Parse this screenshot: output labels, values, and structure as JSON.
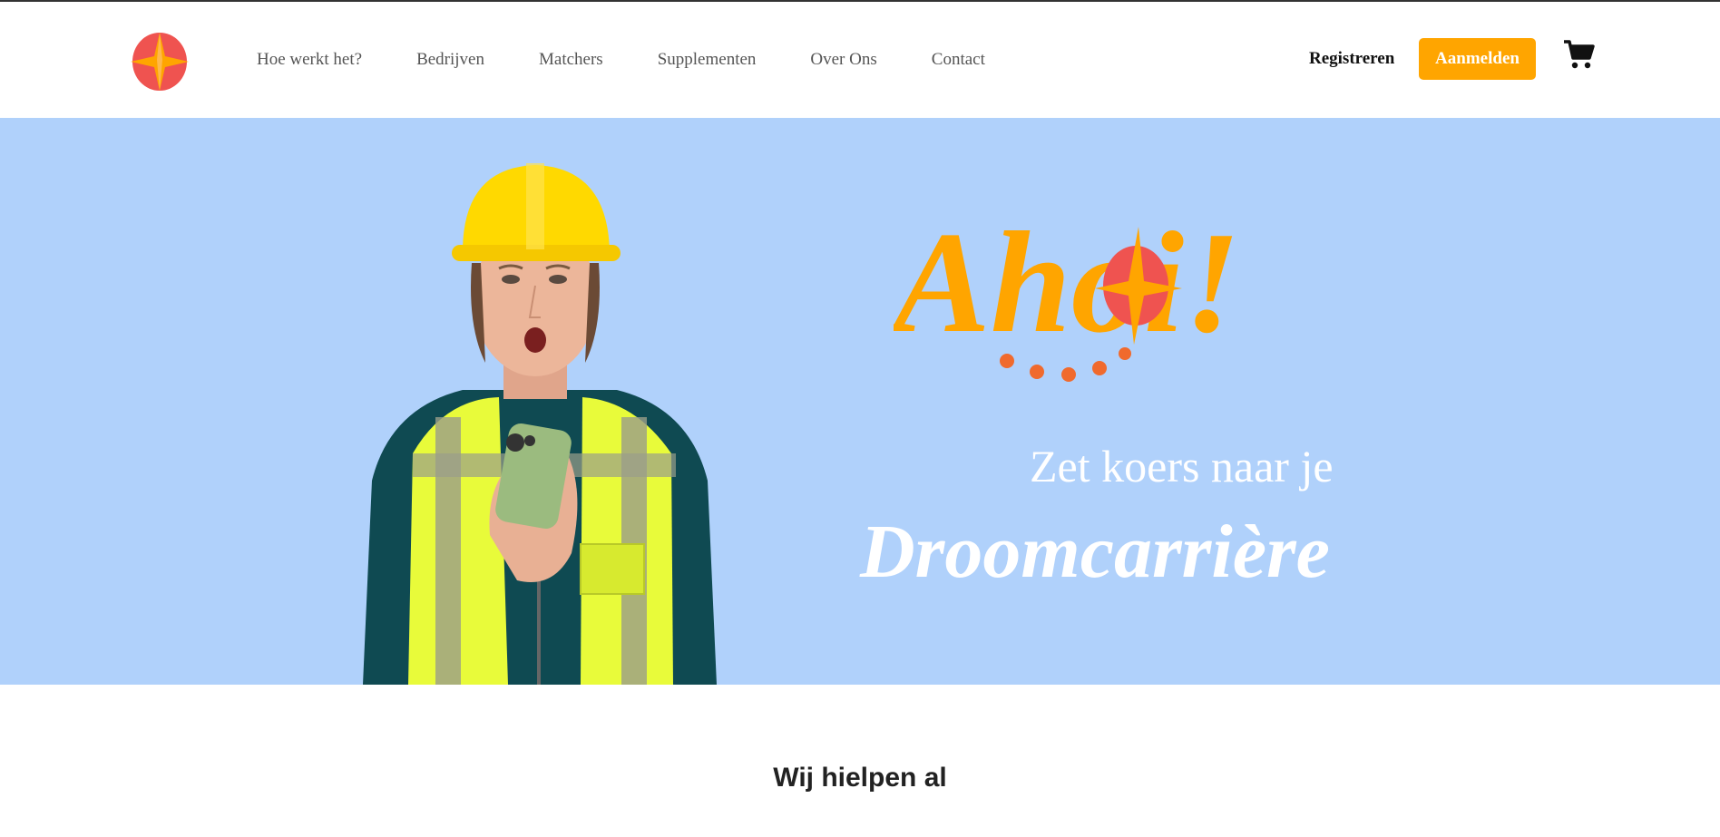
{
  "header": {
    "logo_icon": "compass-logo-icon",
    "nav_items": [
      {
        "label": "Hoe werkt het?"
      },
      {
        "label": "Bedrijven"
      },
      {
        "label": "Matchers"
      },
      {
        "label": "Supplementen"
      },
      {
        "label": "Over Ons"
      },
      {
        "label": "Contact"
      }
    ],
    "register_label": "Registreren",
    "login_label": "Aanmelden",
    "cart_icon": "cart-icon"
  },
  "hero": {
    "logo_text": "Ahoi!",
    "tagline": "Zet koers naar je",
    "highlight": "Droomcarrière",
    "image": "construction-worker-with-phone"
  },
  "section": {
    "title": "Wij hielpen al"
  },
  "colors": {
    "accent_orange": "#ffa500",
    "brand_red": "#ef5350",
    "hero_bg": "#b0d1fb",
    "dots_orange": "#f06a2d"
  }
}
